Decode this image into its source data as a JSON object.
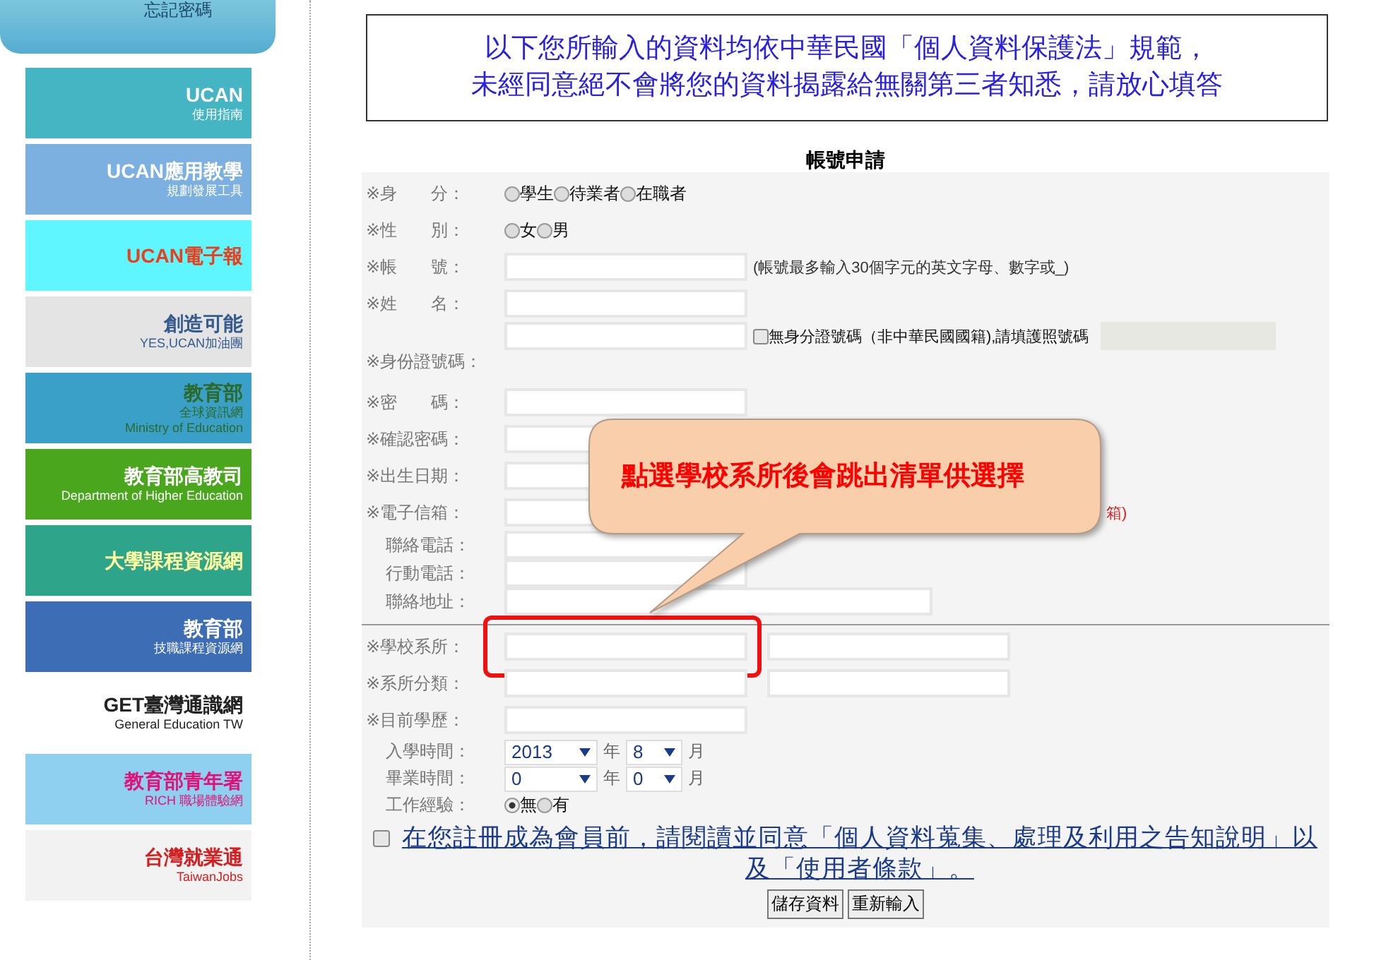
{
  "sidebar": {
    "forgot_password": "忘記密碼",
    "banners": [
      {
        "lines": [
          "UCAN",
          "使用指南"
        ]
      },
      {
        "lines": [
          "UCAN應用教學",
          "規劃發展工具"
        ]
      },
      {
        "lines": [
          "UCAN電子報"
        ]
      },
      {
        "lines": [
          "創造可能",
          "YES,UCAN加油團"
        ]
      },
      {
        "lines": [
          "教育部",
          "全球資訊網",
          "Ministry of Education"
        ]
      },
      {
        "lines": [
          "教育部高教司",
          "Department of Higher Education"
        ]
      },
      {
        "lines": [
          "大學課程資源網"
        ]
      },
      {
        "lines": [
          "教育部",
          "技職課程資源網"
        ]
      },
      {
        "lines": [
          "GET臺灣通識網",
          "General Education TW"
        ]
      },
      {
        "lines": [
          "教育部青年署",
          "RICH 職場體驗網"
        ]
      },
      {
        "lines": [
          "台灣就業通",
          "TaiwanJobs"
        ]
      }
    ]
  },
  "notice": [
    "以下您所輸入的資料均依中華民國「個人資料保護法」規範，",
    "未經同意絕不會將您的資料揭露給無關第三者知悉，請放心填答"
  ],
  "form": {
    "title": "帳號申請",
    "rows": [
      {
        "kind": "radio",
        "label": "※身　　分：",
        "options": [
          {
            "label": "學生",
            "selected": false
          },
          {
            "label": "待業者",
            "selected": false
          },
          {
            "label": "在職者",
            "selected": false
          }
        ]
      },
      {
        "kind": "radio",
        "label": "※性　　別：",
        "options": [
          {
            "label": "女",
            "selected": false
          },
          {
            "label": "男",
            "selected": false
          }
        ]
      },
      {
        "kind": "text",
        "label": "※帳　　號：",
        "hint": {
          "text": "(帳號最多輸入30個字元的英文字母、數字或_)",
          "color": "#333333"
        }
      },
      {
        "kind": "text",
        "label": "※姓　　名："
      },
      {
        "kind": "id",
        "label": "※身份證號碼：",
        "checkbox": {
          "label": "無身分證號碼（非中華民國國籍),請填護照號碼",
          "checked": false
        }
      },
      {
        "kind": "text",
        "label": "※密　　碼："
      },
      {
        "kind": "text",
        "label": "※確認密碼："
      },
      {
        "kind": "text",
        "label": "※出生日期："
      },
      {
        "kind": "text",
        "label": "※電子信箱：",
        "hint": {
          "text": "箱)",
          "color": "#e02020",
          "offset": true
        }
      },
      {
        "kind": "text",
        "label": "聯絡電話：",
        "compact": true
      },
      {
        "kind": "text",
        "label": "行動電話：",
        "compact": true
      },
      {
        "kind": "wide",
        "label": "聯絡地址：",
        "compact": true
      },
      {
        "kind": "divider"
      },
      {
        "kind": "pair",
        "label": "※學校系所：",
        "highlighted": true
      },
      {
        "kind": "pair",
        "label": "※系所分類："
      },
      {
        "kind": "text",
        "label": "※目前學歷："
      },
      {
        "kind": "date",
        "label": "入學時間：",
        "compact": true,
        "year": "2013",
        "year_unit": "年",
        "month": "8",
        "month_unit": "月"
      },
      {
        "kind": "date",
        "label": "畢業時間：",
        "compact": true,
        "year": "0",
        "year_unit": "年",
        "month": "0",
        "month_unit": "月"
      },
      {
        "kind": "radio",
        "label": "工作經驗：",
        "compact": true,
        "options": [
          {
            "label": "無",
            "selected": true
          },
          {
            "label": "有",
            "selected": false
          }
        ]
      }
    ],
    "agreement": {
      "text": "在您註冊成為會員前，請閱讀並同意「個人資料蒐集、處理及利用之告知說明」以及「使用者條款」。",
      "checked": false
    },
    "buttons": [
      "儲存資料",
      "重新輸入"
    ]
  },
  "callout": "點選學校系所後會跳出清單供選擇"
}
